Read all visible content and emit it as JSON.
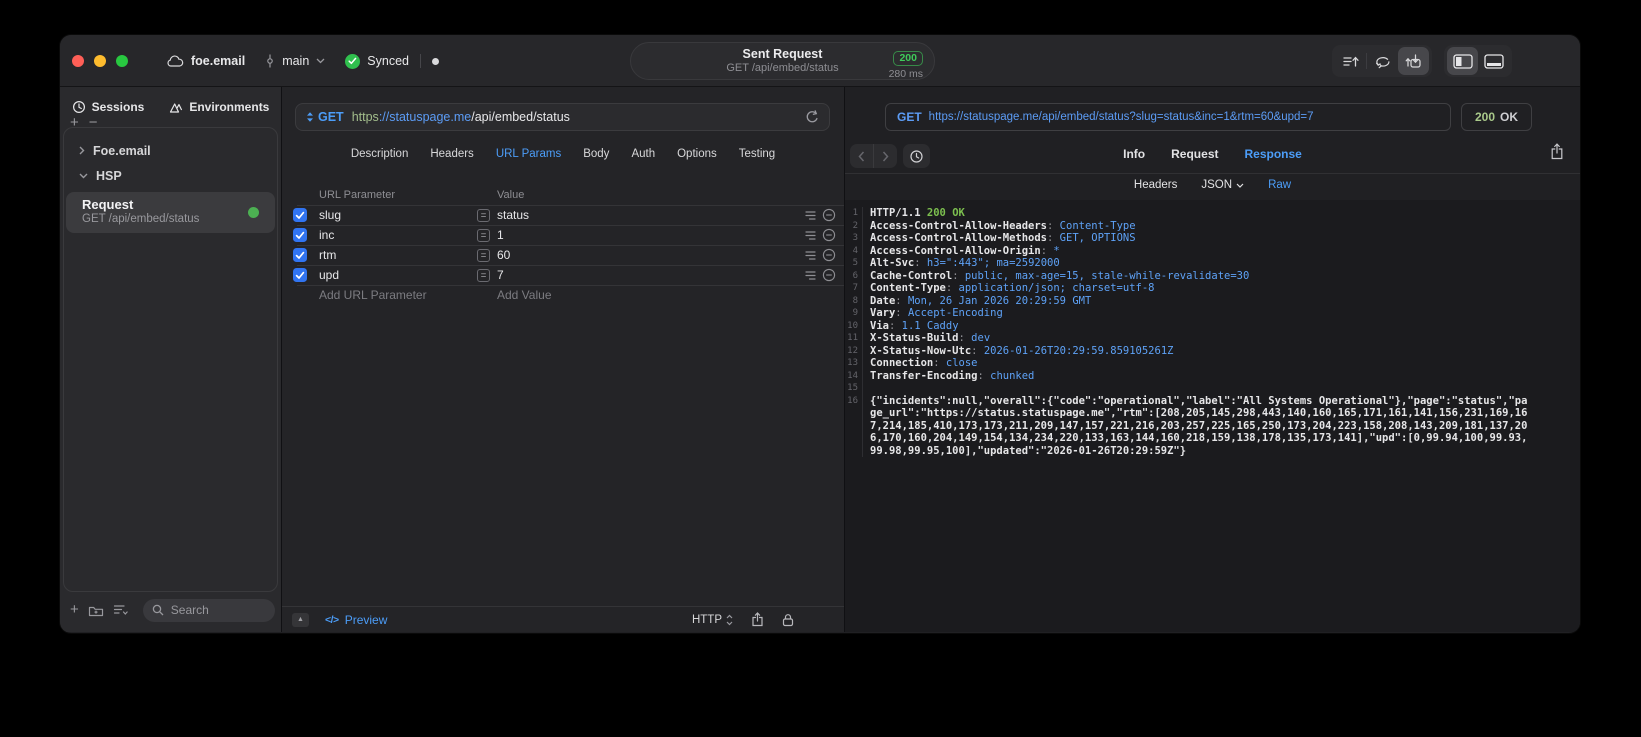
{
  "titlebar": {
    "project": "foe.email",
    "branch": "main",
    "sync_label": "Synced",
    "request_summary": {
      "title": "Sent Request",
      "subtitle": "GET /api/embed/status",
      "status_code": "200",
      "duration": "280 ms"
    }
  },
  "sidebar": {
    "tabs": [
      {
        "label": "Sessions",
        "icon": "history-clock-icon",
        "active": true
      },
      {
        "label": "Environments",
        "icon": "layers-icon",
        "active": false
      }
    ],
    "tree": [
      {
        "label": "Foe.email",
        "expanded": false
      },
      {
        "label": "HSP",
        "expanded": true
      }
    ],
    "request_item": {
      "title": "Request",
      "subtitle": "GET /api/embed/status"
    },
    "search_placeholder": "Search"
  },
  "request_editor": {
    "method": "GET",
    "url": {
      "scheme": "https",
      "host": "://statuspage.me",
      "path": "/api/embed/status"
    },
    "tabs": [
      "Description",
      "Headers",
      "URL Params",
      "Body",
      "Auth",
      "Options",
      "Testing"
    ],
    "active_tab": "URL Params",
    "params_table": {
      "columns": [
        "URL Parameter",
        "Value"
      ],
      "rows": [
        {
          "enabled": true,
          "name": "slug",
          "value": "status"
        },
        {
          "enabled": true,
          "name": "inc",
          "value": "1"
        },
        {
          "enabled": true,
          "name": "rtm",
          "value": "60"
        },
        {
          "enabled": true,
          "name": "upd",
          "value": "7"
        }
      ],
      "add_parameter_placeholder": "Add URL Parameter",
      "add_value_placeholder": "Add Value"
    },
    "footer": {
      "preview_label": "Preview",
      "protocol_label": "HTTP"
    }
  },
  "response_viewer": {
    "request_line": {
      "method": "GET",
      "url": "https://statuspage.me/api/embed/status?slug=status&inc=1&rtm=60&upd=7"
    },
    "status": {
      "code": "200",
      "text": "OK"
    },
    "tabs": [
      "Info",
      "Request",
      "Response"
    ],
    "active_tab": "Response",
    "subtabs": [
      "Headers",
      "JSON",
      "Raw"
    ],
    "active_subtab": "Raw",
    "raw_response": {
      "status_line": "HTTP/1.1 200 OK",
      "headers": [
        {
          "name": "Access-Control-Allow-Headers",
          "value": "Content-Type"
        },
        {
          "name": "Access-Control-Allow-Methods",
          "value": "GET, OPTIONS"
        },
        {
          "name": "Access-Control-Allow-Origin",
          "value": "*"
        },
        {
          "name": "Alt-Svc",
          "value": "h3=\":443\"; ma=2592000"
        },
        {
          "name": "Cache-Control",
          "value": "public, max-age=15, stale-while-revalidate=30"
        },
        {
          "name": "Content-Type",
          "value": "application/json; charset=utf-8"
        },
        {
          "name": "Date",
          "value": "Mon, 26 Jan 2026 20:29:59 GMT"
        },
        {
          "name": "Vary",
          "value": "Accept-Encoding"
        },
        {
          "name": "Via",
          "value": "1.1 Caddy"
        },
        {
          "name": "X-Status-Build",
          "value": "dev"
        },
        {
          "name": "X-Status-Now-Utc",
          "value": "2026-01-26T20:29:59.859105261Z"
        },
        {
          "name": "Connection",
          "value": "close"
        },
        {
          "name": "Transfer-Encoding",
          "value": "chunked"
        }
      ],
      "body": "{\"incidents\":null,\"overall\":{\"code\":\"operational\",\"label\":\"All Systems Operational\"},\"page\":\"status\",\"page_url\":\"https://status.statuspage.me\",\"rtm\":[208,205,145,298,443,140,160,165,171,161,141,156,231,169,167,214,185,410,173,173,211,209,147,157,221,216,203,257,225,165,250,173,204,223,158,208,143,209,181,137,206,170,160,204,149,154,134,234,220,133,163,144,160,218,159,138,178,135,173,141],\"upd\":[0,99.94,100,99.93,99.98,99.95,100],\"updated\":\"2026-01-26T20:29:59Z\"}"
    }
  },
  "icons": {
    "add": "+",
    "remove": "−",
    "equals": "=",
    "panel_toggle": "▲",
    "code_preview": "</>"
  },
  "colors": {
    "accent_blue": "#4C9DF8",
    "url_blue": "#5C9CF5",
    "scheme_green": "#A3BE8C",
    "success_green": "#30C04E",
    "response_ok_green": "#7CBF4F",
    "status_green_soft": "#A9C98A",
    "checkbox_blue": "#3174F1",
    "request_dot_green": "#4CB052"
  }
}
